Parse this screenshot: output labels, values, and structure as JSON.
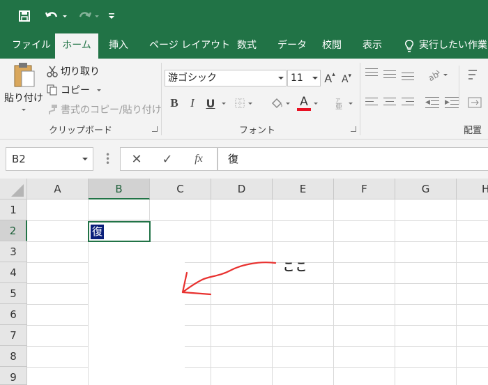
{
  "quick_access": {
    "save_icon": "save-icon",
    "undo_icon": "undo-icon",
    "redo_icon": "redo-icon",
    "customize_icon": "qat-customize-icon"
  },
  "ribbon_tabs": [
    {
      "label": "ファイル"
    },
    {
      "label": "ホーム"
    },
    {
      "label": "挿入"
    },
    {
      "label": "ページ レイアウト"
    },
    {
      "label": "数式"
    },
    {
      "label": "データ"
    },
    {
      "label": "校閲"
    },
    {
      "label": "表示"
    },
    {
      "label": "実行したい作業を"
    }
  ],
  "clipboard": {
    "paste_label": "貼り付け",
    "cut_label": "切り取り",
    "copy_label": "コピー",
    "format_painter_label": "書式のコピー/貼り付け",
    "group_label": "クリップボード"
  },
  "font": {
    "font_name": "游ゴシック",
    "font_size": "11",
    "bold": "B",
    "italic": "I",
    "underline": "U",
    "font_color_glyph": "A",
    "font_color": "#e81123",
    "group_label": "フォント"
  },
  "alignment": {
    "group_label": "配置"
  },
  "formula_bar": {
    "name_box": "B2",
    "cancel_glyph": "✕",
    "enter_glyph": "✓",
    "fx_label": "fx",
    "content": "復"
  },
  "sheet": {
    "columns": [
      "A",
      "B",
      "C",
      "D",
      "E",
      "F",
      "G",
      "H"
    ],
    "rows": [
      "1",
      "2",
      "3",
      "4",
      "5",
      "6",
      "7",
      "8",
      "9"
    ],
    "selected_column": "B",
    "selected_row": "2",
    "active_cell_value": "復"
  },
  "annotation": {
    "text": "ここ",
    "arrow_color": "#e8312f"
  },
  "colors": {
    "excel_green": "#217346",
    "ribbon_bg": "#f3f3f3",
    "selection_highlight": "#0a1f7a"
  }
}
